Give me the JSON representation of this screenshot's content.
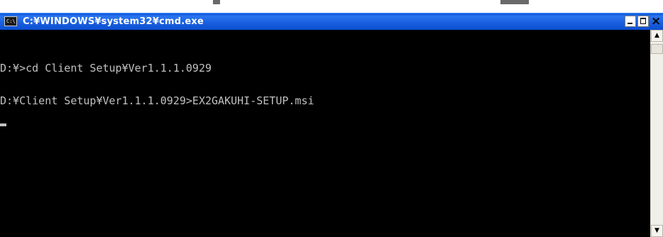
{
  "window": {
    "title": "C:¥WINDOWS¥system32¥cmd.exe",
    "icon_label": "C:\\",
    "icon": "console-icon"
  },
  "titlebar_buttons": {
    "minimize_icon": "minimize-icon",
    "maximize_icon": "maximize-icon",
    "close_icon": "close-icon",
    "close_glyph": "×"
  },
  "console": {
    "lines": [
      "D:¥>cd Client Setup¥Ver1.1.1.0929",
      "D:¥Client Setup¥Ver1.1.1.0929>EX2GAKUHI-SETUP.msi"
    ],
    "text_color": "#c0c0c0",
    "background": "#000000"
  },
  "scrollbar": {
    "up_glyph": "▲",
    "down_glyph": "▼"
  },
  "colors": {
    "titlebar": "#1a60e0",
    "title_text": "#ffffff"
  }
}
